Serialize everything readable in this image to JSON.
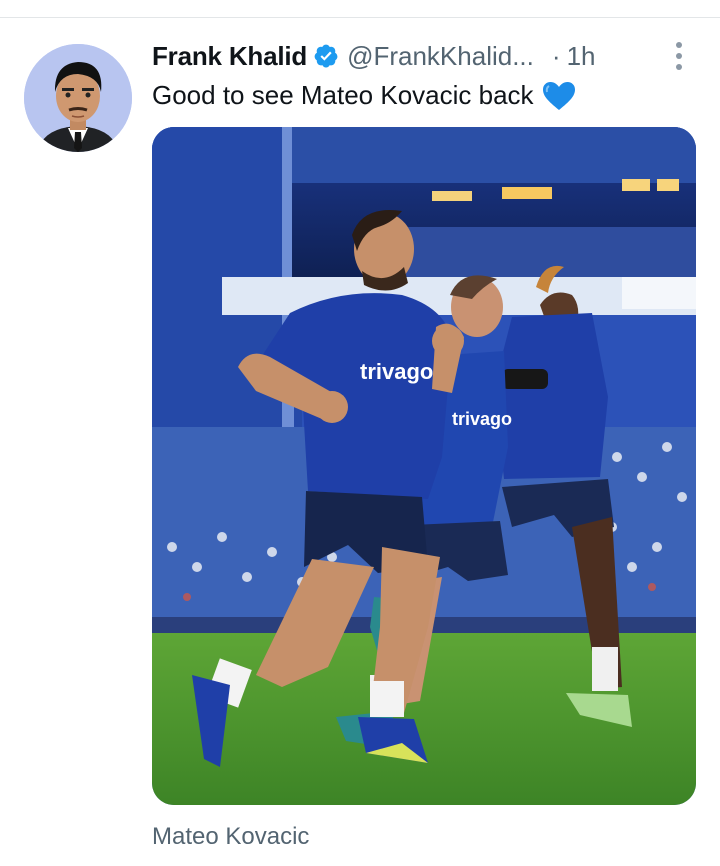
{
  "tweet": {
    "display_name": "Frank Khalid",
    "handle": "@FrankKhalid...",
    "separator": "·",
    "time": "1h",
    "text": "Good to see Mateo Kovacic back",
    "emoji": "blue-heart-icon",
    "media_caption": "Mateo Kovacic",
    "shirt_sponsor": "trivago"
  },
  "colors": {
    "verified": "#1d9bf0",
    "heart": "#1d8ce8",
    "muted_text": "#536471",
    "kit_blue": "#1f3fa8",
    "pitch_green": "#4f9a2c"
  }
}
